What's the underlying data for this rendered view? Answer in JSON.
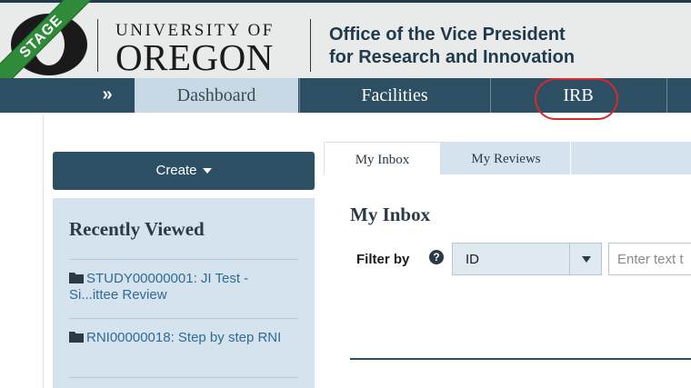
{
  "header": {
    "stage_label": "STAGE",
    "university_line1": "UNIVERSITY OF",
    "university_line2": "OREGON",
    "office_line1": "Office of the Vice President",
    "office_line2": "for Research and Innovation"
  },
  "nav": {
    "collapse_icon": "»",
    "items": [
      {
        "label": "Dashboard",
        "active": true
      },
      {
        "label": "Facilities",
        "active": false
      },
      {
        "label": "IRB",
        "active": false
      }
    ],
    "highlight_color": "#d62a2a"
  },
  "sidebar": {
    "create_label": "Create",
    "recent_title": "Recently Viewed",
    "recent_items": [
      {
        "text": "STUDY00000001: JI Test - Si...ittee Review",
        "icon": "folder-icon"
      },
      {
        "text": "RNI00000018: Step by step RNI",
        "icon": "folder-icon"
      }
    ]
  },
  "main": {
    "tabs": [
      {
        "label": "My Inbox",
        "selected": true
      },
      {
        "label": "My Reviews",
        "selected": false
      }
    ],
    "title": "My Inbox",
    "filter_label": "Filter by",
    "filter_select_value": "ID",
    "filter_input_placeholder": "Enter text t"
  },
  "colors": {
    "nav_bg": "#2d4f63",
    "active_tab": "#c8d9e6",
    "panel_bg": "#d4e3ed",
    "stage_green": "#2f8a3a"
  }
}
